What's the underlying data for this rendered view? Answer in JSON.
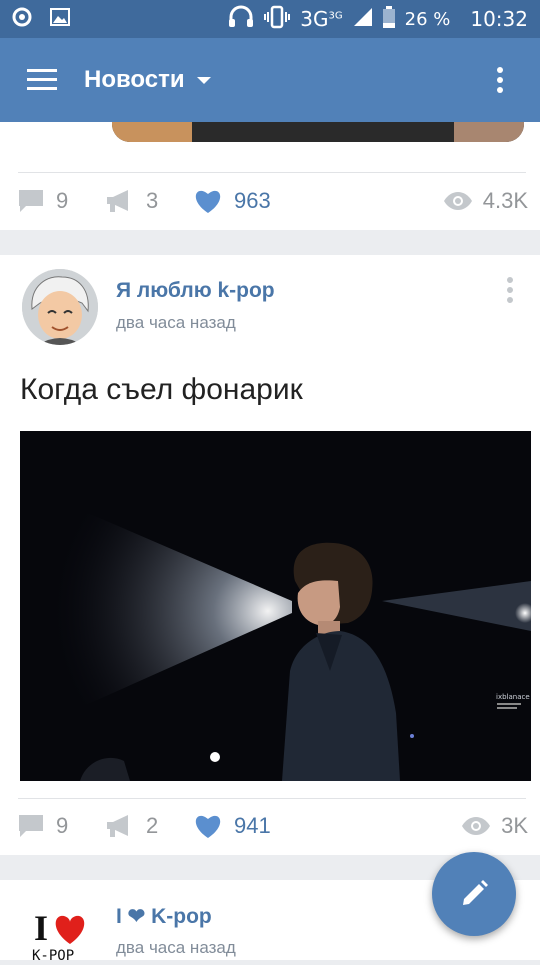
{
  "status_bar": {
    "network": "3G",
    "network_sup": "3G",
    "battery": "26 %",
    "clock": "10:32"
  },
  "app_bar": {
    "title": "Новости"
  },
  "posts": [
    {
      "comments": "9",
      "reposts": "3",
      "likes": "963",
      "views": "4.3K"
    },
    {
      "author": "Я люблю k-pop",
      "time": "два часа назад",
      "text": "Когда съел фонарик",
      "photo_watermark": "ixblanace",
      "comments": "9",
      "reposts": "2",
      "likes": "941",
      "views": "3K"
    },
    {
      "author": "I ❤ K-pop",
      "time": "два часа назад",
      "logo_text_top": "I",
      "logo_text_bottom": "K-POP"
    }
  ],
  "colors": {
    "status_bar": "#3f6a9c",
    "app_bar": "#5181b8",
    "link": "#4a76a8",
    "like": "#4a76a8",
    "muted": "#939699"
  }
}
